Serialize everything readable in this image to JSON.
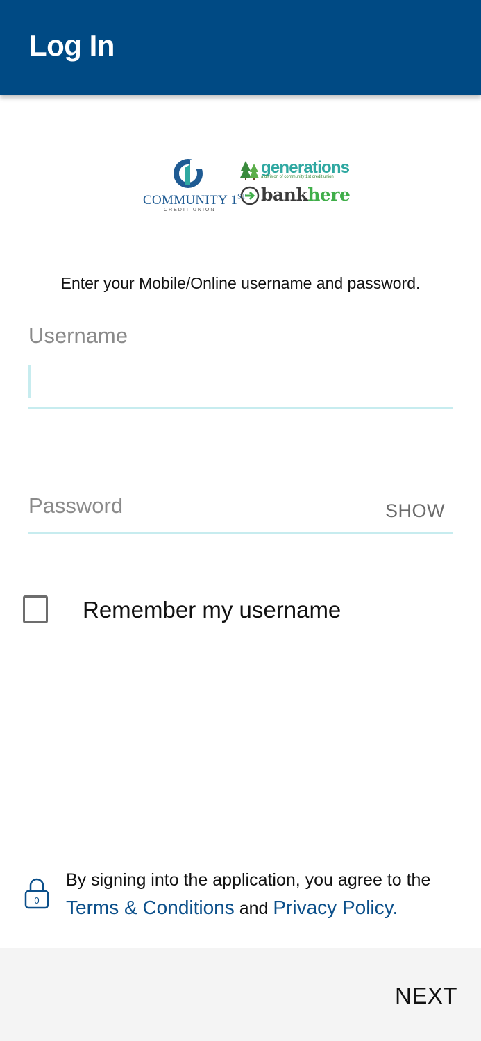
{
  "header": {
    "title": "Log In",
    "background": "#004a84"
  },
  "logo": {
    "primary_name": "COMMUNITY 1",
    "primary_superscript": "ST",
    "primary_sub": "CREDIT UNION",
    "secondary_name": "generations",
    "secondary_tagline": "a division of community 1st credit union",
    "bank_part1": "bank",
    "bank_part2": "here"
  },
  "instruction": "Enter your Mobile/Online username and password.",
  "username": {
    "label": "Username",
    "value": ""
  },
  "password": {
    "label": "Password",
    "value": "",
    "show_label": "SHOW"
  },
  "remember": {
    "label": "Remember my username",
    "checked": false
  },
  "legal": {
    "text_before": "By signing into the application, you agree to the",
    "terms_link": "Terms & Conditions",
    "connector": "and",
    "privacy_link": "Privacy Policy.",
    "lock_icon_text": "0"
  },
  "footer": {
    "next_label": "NEXT"
  },
  "colors": {
    "accent": "#0b4f8a",
    "field_line": "#c7ecef",
    "footer_bg": "#f4f4f4"
  }
}
